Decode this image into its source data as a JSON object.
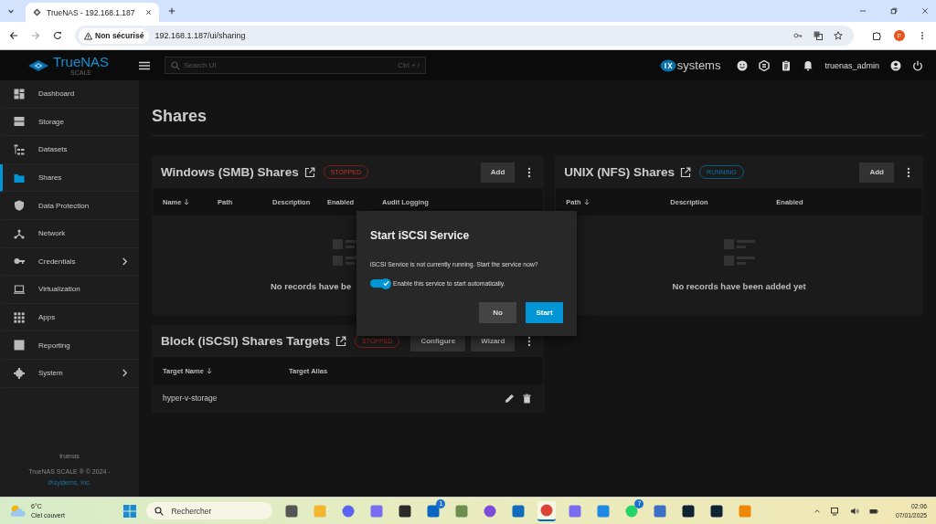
{
  "browser": {
    "tab_title": "TrueNAS - 192.168.1.187",
    "security": "Non sécurisé",
    "url": "192.168.1.187/ui/sharing",
    "profile": "F"
  },
  "app": {
    "logo": "TrueNAS",
    "logo_sub": "SCALE",
    "search": {
      "placeholder": "Search UI",
      "shortcut": "Ctrl + /"
    },
    "vendor": "systems",
    "user": "truenas_admin"
  },
  "sidebar": {
    "items": [
      {
        "label": "Dashboard",
        "selected": false,
        "expandable": false
      },
      {
        "label": "Storage",
        "selected": false,
        "expandable": false
      },
      {
        "label": "Datasets",
        "selected": false,
        "expandable": false
      },
      {
        "label": "Shares",
        "selected": true,
        "expandable": false
      },
      {
        "label": "Data Protection",
        "selected": false,
        "expandable": false
      },
      {
        "label": "Network",
        "selected": false,
        "expandable": false
      },
      {
        "label": "Credentials",
        "selected": false,
        "expandable": true
      },
      {
        "label": "Virtualization",
        "selected": false,
        "expandable": false
      },
      {
        "label": "Apps",
        "selected": false,
        "expandable": false
      },
      {
        "label": "Reporting",
        "selected": false,
        "expandable": false
      },
      {
        "label": "System",
        "selected": false,
        "expandable": true
      }
    ],
    "hostname": "truenas",
    "copyright": "TrueNAS SCALE ® © 2024 -",
    "company": "iXsystems, Inc."
  },
  "page": {
    "title": "Shares"
  },
  "panels": [
    {
      "kind": "smb",
      "title": "Windows (SMB) Shares",
      "status": {
        "label": "STOPPED",
        "running": false
      },
      "actions": [
        "Add"
      ],
      "columns": [
        {
          "label": "Name",
          "sorted": true
        },
        {
          "label": "Path",
          "sorted": false
        },
        {
          "label": "Description",
          "sorted": false
        },
        {
          "label": "Enabled",
          "sorted": false
        },
        {
          "label": "Audit Logging",
          "sorted": false
        }
      ],
      "empty_text": "No records have be"
    },
    {
      "kind": "iscsi",
      "title": "Block (iSCSI) Shares Targets",
      "status": {
        "label": "STOPPED",
        "running": false
      },
      "actions": [
        "Configure",
        "Wizard"
      ],
      "columns": [
        {
          "label": "Target Name",
          "sorted": true
        },
        {
          "label": "Target Alias",
          "sorted": false
        }
      ],
      "rows": [
        {
          "target_name": "hyper-v-storage"
        }
      ]
    },
    {
      "kind": "nfs",
      "title": "UNIX (NFS) Shares",
      "status": {
        "label": "RUNNING",
        "running": true
      },
      "actions": [
        "Add"
      ],
      "columns": [
        {
          "label": "Path",
          "sorted": true
        },
        {
          "label": "Description",
          "sorted": false
        },
        {
          "label": "Enabled",
          "sorted": false
        }
      ],
      "empty_text": "No records have been added yet"
    }
  ],
  "dialog": {
    "title": "Start iSCSI Service",
    "message": "iSCSI Service is not currently running. Start the service now?",
    "toggle": {
      "label": "Enable this service to start automatically.",
      "on": true
    },
    "buttons": [
      {
        "label": "No",
        "primary": false
      },
      {
        "label": "Start",
        "primary": true
      }
    ]
  },
  "taskbar": {
    "weather": {
      "temp": "6°C",
      "condition": "Ciel couvert"
    },
    "search_placeholder": "Rechercher",
    "apps": [
      {
        "kind": "taskview",
        "active": false
      },
      {
        "kind": "files",
        "active": false
      },
      {
        "kind": "discord",
        "active": false
      },
      {
        "kind": "copilot",
        "active": false
      },
      {
        "kind": "terminal",
        "active": false
      },
      {
        "kind": "linkedin",
        "badge": "1",
        "active": false
      },
      {
        "kind": "maps",
        "active": false
      },
      {
        "kind": "canva",
        "active": false
      },
      {
        "kind": "outlook",
        "active": false
      },
      {
        "kind": "chrome",
        "active": true
      },
      {
        "kind": "copilot",
        "active": false
      },
      {
        "kind": "vscode",
        "active": false
      },
      {
        "kind": "whatsapp",
        "badge": "7",
        "active": false
      },
      {
        "kind": "powershell",
        "active": false
      },
      {
        "kind": "darkapp",
        "active": false
      },
      {
        "kind": "darkapp",
        "active": false
      },
      {
        "kind": "drawio",
        "active": false
      }
    ],
    "time": "02:06",
    "date": "07/01/2025"
  }
}
